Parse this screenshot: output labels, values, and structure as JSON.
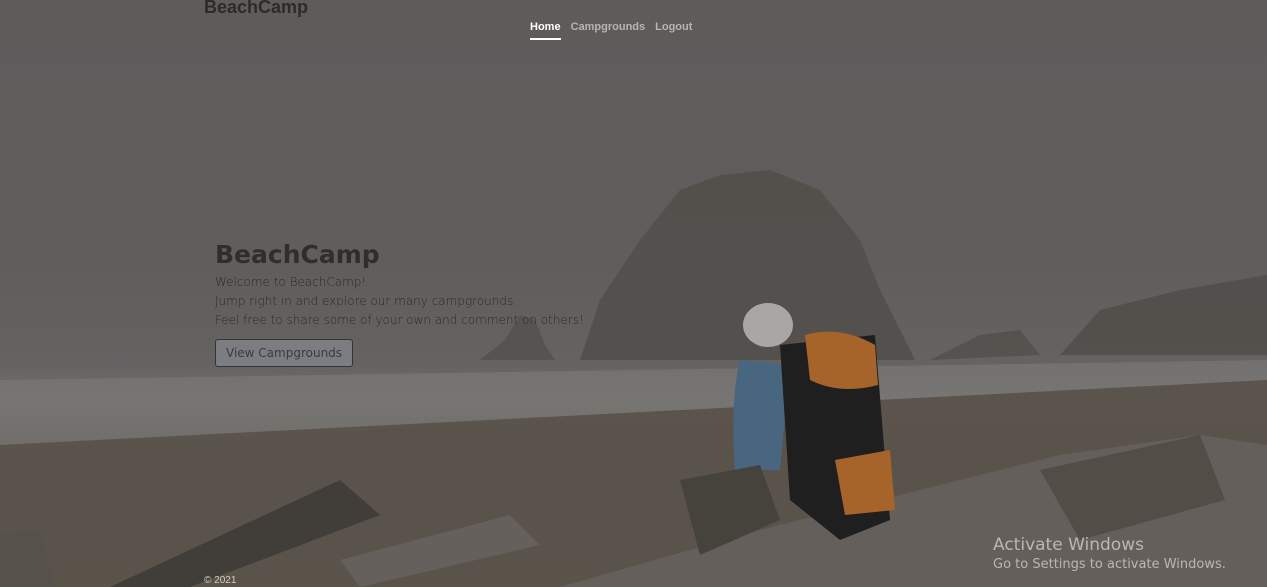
{
  "brand": "BeachCamp",
  "nav": {
    "items": [
      "Home",
      "Campgrounds",
      "Logout"
    ]
  },
  "hero": {
    "title": "BeachCamp",
    "lines": [
      "Welcome to BeachCamp!",
      "Jump right in and explore our many campgrounds.",
      "Feel free to share some of your own and comment on others!"
    ],
    "button_label": "View Campgrounds"
  },
  "footer": {
    "copyright": "© 2021"
  },
  "watermark": {
    "title": "Activate Windows",
    "subtitle": "Go to Settings to activate Windows."
  },
  "colors": {
    "nav_active": "#ffffff",
    "nav_inactive": "#b7b5b2",
    "button_bg": "#7b7d82",
    "text_dark": "#2c2b2a"
  }
}
